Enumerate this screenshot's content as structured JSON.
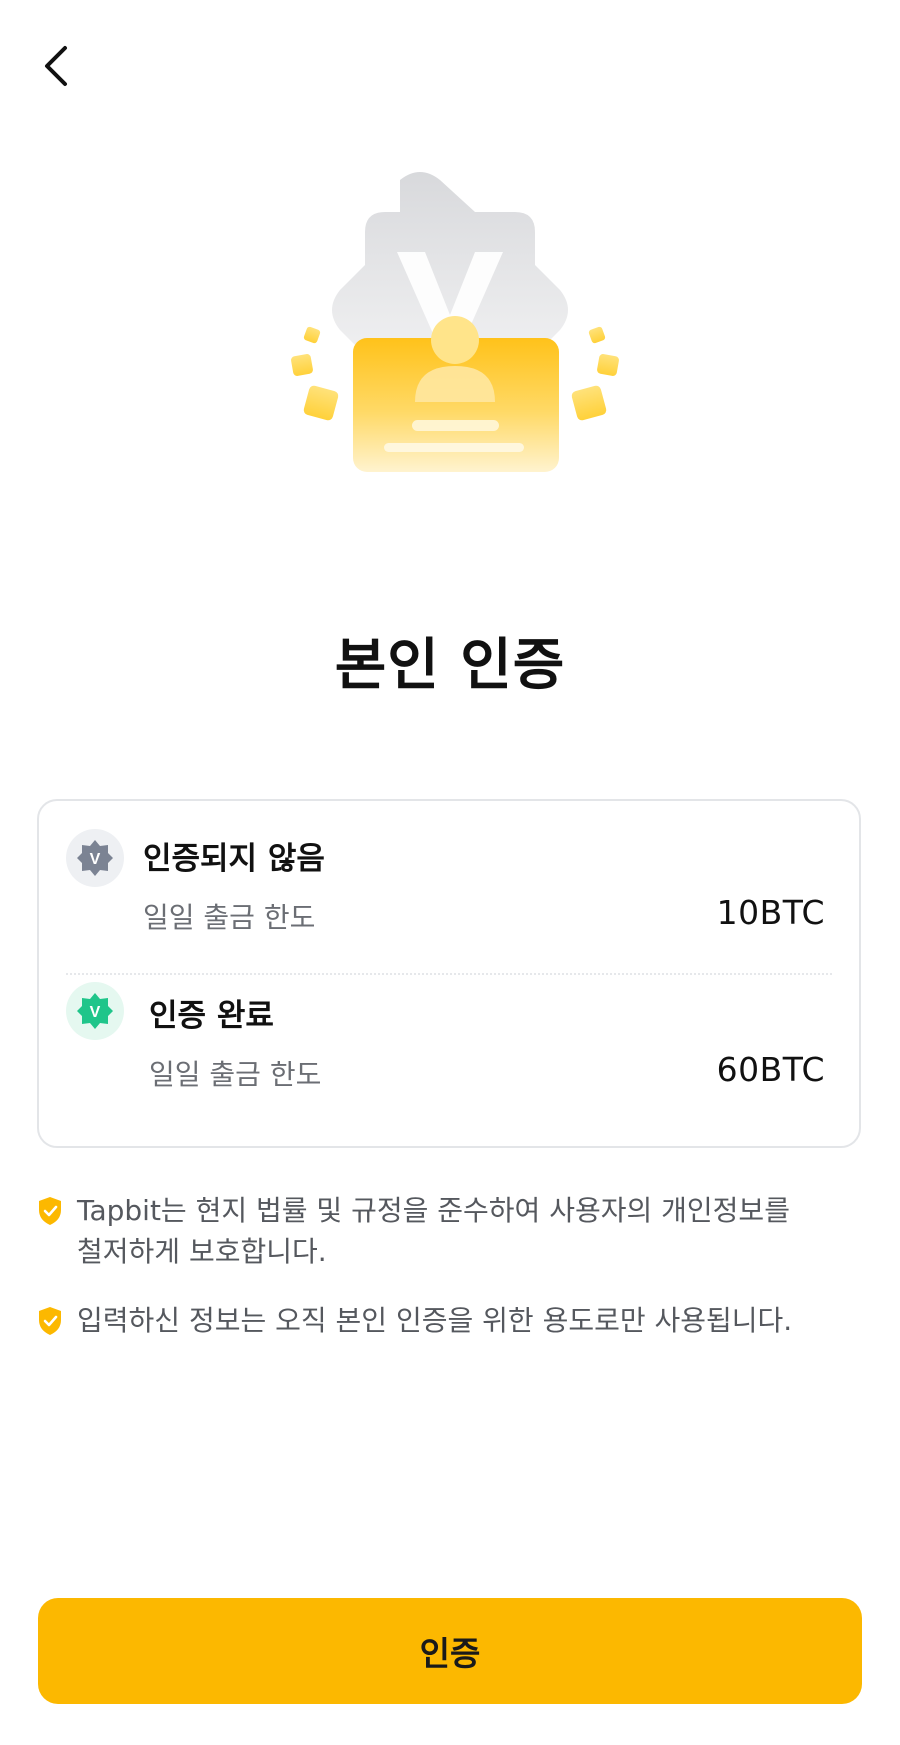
{
  "header": {
    "back_icon": "chevron-left-icon"
  },
  "hero": {
    "icon": "verified-id-card-illustration"
  },
  "page": {
    "title": "본인 인증"
  },
  "levels": [
    {
      "name": "인증되지 않음",
      "limit_label": "일일 출금 한도",
      "limit_value": "10BTC",
      "badge_icon": "unverified-badge-icon",
      "badge_color": "#7b8393"
    },
    {
      "name": "인증 완료",
      "limit_label": "일일 출금 한도",
      "limit_value": "60BTC",
      "badge_icon": "verified-badge-icon",
      "badge_color": "#1fc58a"
    }
  ],
  "notes": [
    {
      "icon": "shield-check-icon",
      "line1": "Tapbit는 현지 법률 및 규정을 준수하여 사용자의 개인정보를",
      "line2": "철저하게 보호합니다."
    },
    {
      "icon": "shield-check-icon",
      "line1": "입력하신 정보는 오직 본인 인증을 위한 용도로만 사용됩니다.",
      "line2": ""
    }
  ],
  "cta": {
    "label": "인증"
  },
  "colors": {
    "accent": "#fcb800",
    "text": "#111111",
    "muted": "#6b6e74"
  }
}
